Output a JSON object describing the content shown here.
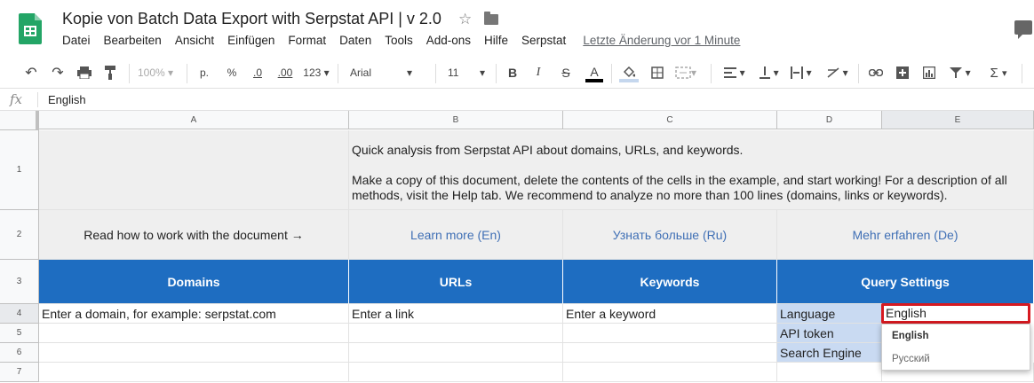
{
  "doc": {
    "title": "Kopie von Batch Data Export with Serpstat API |  v 2.0",
    "star_icon": "star-icon",
    "folder_icon": "folder-icon"
  },
  "menu": [
    "Datei",
    "Bearbeiten",
    "Ansicht",
    "Einfügen",
    "Format",
    "Daten",
    "Tools",
    "Add-ons",
    "Hilfe",
    "Serpstat"
  ],
  "last_edit": "Letzte Änderung vor 1 Minute",
  "toolbar": {
    "zoom": "100%",
    "currency": "p.",
    "percent": "%",
    "dec_less": ".0",
    "dec_more": ".00",
    "more_formats": "123",
    "font": "Arial",
    "size": "11",
    "bold": "B",
    "italic": "I",
    "strike": "S",
    "text_color": "A",
    "sum": "Σ"
  },
  "formula": {
    "fx": "fx",
    "value": "English"
  },
  "columns": [
    "A",
    "B",
    "C",
    "D",
    "E"
  ],
  "rows": [
    "1",
    "2",
    "3",
    "4",
    "5",
    "6",
    "7"
  ],
  "row1": {
    "line1": "Quick analysis from Serpstat API about domains, URLs, and keywords.",
    "line2": "Make a copy of this document, delete the contents of the cells in the example, and start working! For a description of all",
    "line3": "methods, visit the Help tab. We recommend to analyze no more than 100 lines (domains, links or keywords)."
  },
  "row2": {
    "a": "Read how to work with the document →",
    "b": "Learn more (En)",
    "c": "Узнать больше (Ru)",
    "d": "Mehr erfahren (De)"
  },
  "row3": {
    "a": "Domains",
    "b": "URLs",
    "c": "Keywords",
    "d": "Query Settings"
  },
  "row4": {
    "a": "Enter a domain, for example: serpstat.com",
    "b": "Enter a link",
    "c": "Enter a keyword",
    "d": "Language",
    "e": "English"
  },
  "row5": {
    "d": "API token"
  },
  "row6": {
    "d": "Search Engine"
  },
  "dropdown": [
    "English",
    "Русский"
  ],
  "colors": {
    "header_blue": "#1e6dc1",
    "label_blue": "#c9daf2",
    "selection_red": "#d71a21",
    "brand_green": "#23a566"
  }
}
